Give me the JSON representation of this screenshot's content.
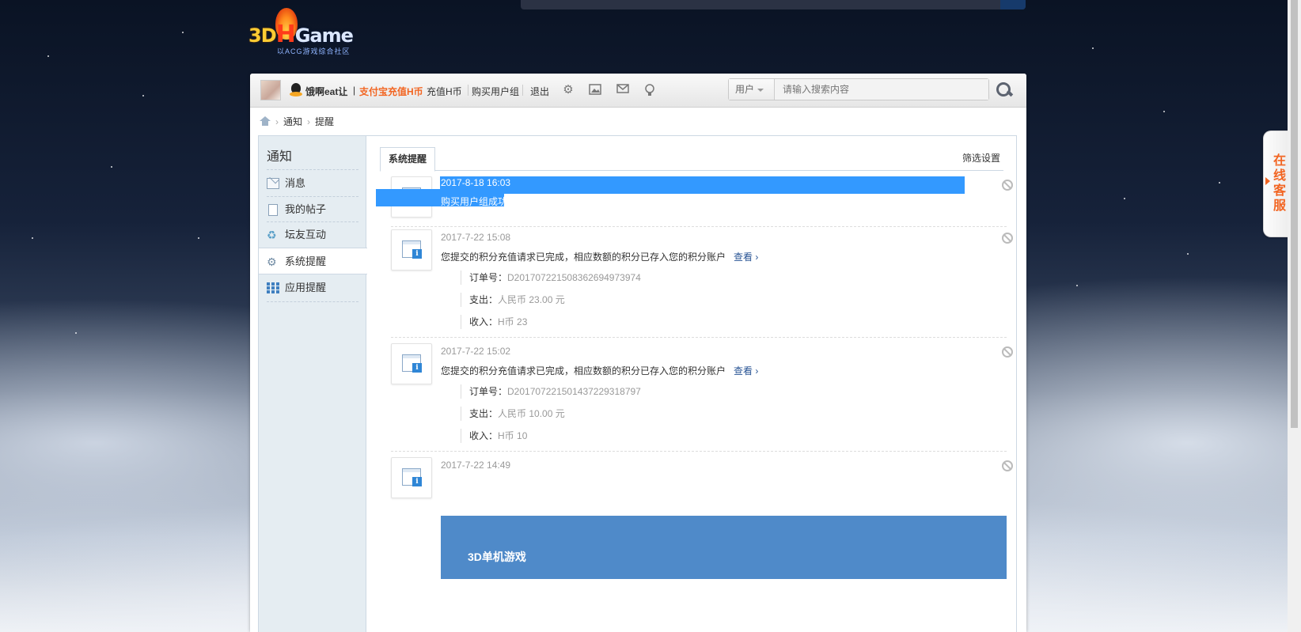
{
  "header": {
    "logo_text_3d": "3D",
    "logo_text_h": "H",
    "logo_text_game": "Game",
    "logo_slogan": "以ACG游戏综合社区"
  },
  "toolbar": {
    "username": "饿啊eat让",
    "separator": "|",
    "alipay_recharge": "支付宝充值H币",
    "recharge": "充值H币",
    "buy_usergroup": "购买用户组",
    "logout": "退出",
    "search_type": "用户",
    "search_placeholder": "请输入搜索内容"
  },
  "breadcrumb": {
    "items": [
      "通知",
      "提醒"
    ]
  },
  "sidebar": {
    "title": "通知",
    "items": [
      {
        "label": "消息",
        "icon": "mail-icon"
      },
      {
        "label": "我的帖子",
        "icon": "document-icon"
      },
      {
        "label": "坛友互动",
        "icon": "recycle-icon"
      },
      {
        "label": "系统提醒",
        "icon": "gear-icon",
        "active": true
      },
      {
        "label": "应用提醒",
        "icon": "grid-icon"
      }
    ]
  },
  "main": {
    "tab_active": "系统提醒",
    "filter_settings": "筛选设置",
    "notices": [
      {
        "time": "2017-8-18 16:03",
        "message": "购买用户组成功",
        "selected": true
      },
      {
        "time": "2017-7-22 15:08",
        "message": "您提交的积分充值请求已完成，相应数额的积分已存入您的积分账户",
        "link": "查看 ›",
        "order_label": "订单号：",
        "order_value": "D20170722150836269497397​4",
        "pay_label": "支出：",
        "pay_value": "人民币 23.00 元",
        "income_label": "收入：",
        "income_value": "H币 23"
      },
      {
        "time": "2017-7-22 15:02",
        "message": "您提交的积分充值请求已完成，相应数额的积分已存入您的积分账户",
        "link": "查看 ›",
        "order_label": "订单号：",
        "order_value": "D201707221501437229318797",
        "pay_label": "支出：",
        "pay_value": "人民币 10.00 元",
        "income_label": "收入：",
        "income_value": "H币 10"
      },
      {
        "time": "2017-7-22 14:49"
      }
    ],
    "banner_text": "3D单机游戏"
  },
  "online_service": {
    "label": "在线客服"
  },
  "colors": {
    "accent_orange": "#f26522",
    "selection_blue": "#3399ff",
    "banner_blue": "#4f8ac9",
    "link_blue": "#2a5595"
  }
}
